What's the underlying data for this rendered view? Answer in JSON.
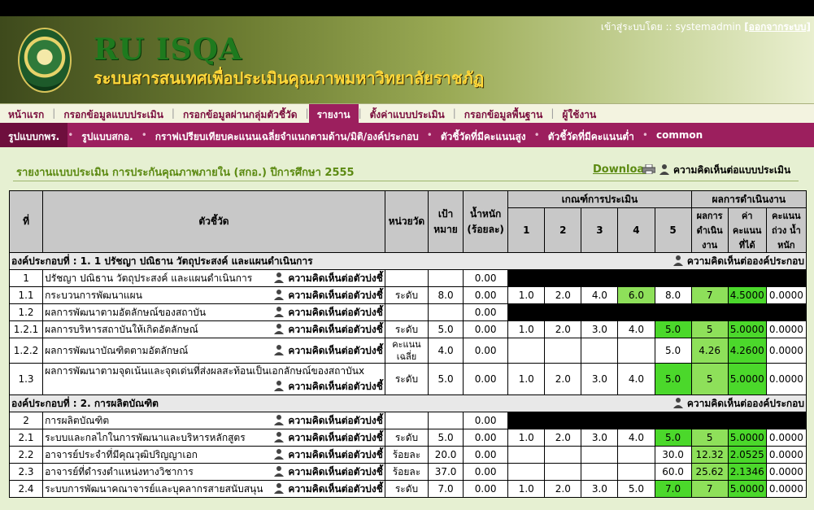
{
  "header": {
    "brand": "RU ISQA",
    "subtitle": "ระบบสารสนเทศเพื่อประเมินคุณภาพมหาวิทยาลัยราชภัฏ",
    "login_prefix": "เข้าสู่ระบบโดย :: systemadmin",
    "logout": "[ออกจากระบบ]"
  },
  "menu1": [
    "หน้าแรก",
    "กรอกข้อมูลแบบประเมิน",
    "กรอกข้อมูลผ่านกลุ่มตัวชี้วัด",
    "รายงาน",
    "ตั้งค่าแบบประเมิน",
    "กรอกข้อมูลพื้นฐาน",
    "ผู้ใช้งาน"
  ],
  "menu2": [
    "รูปแบบกพร.",
    "รูปแบบสกอ.",
    "กราฟเปรียบเทียบคะแนนเฉลี่ยจำแนกตามด้าน/มิติ/องค์ประกอบ",
    "ตัวชี้วัดที่มีคะแนนสูง",
    "ตัวชี้วัดที่มีคะแนนต่ำ",
    "common"
  ],
  "report": {
    "title": "รายงานแบบประเมิน การประกันคุณภาพภายใน (สกอ.) ปีการศึกษา 2555",
    "download": "Download",
    "comment_form": "ความคิดเห็นต่อแบบประเมิน"
  },
  "table": {
    "h_no": "ที่",
    "h_indicator": "ตัวชี้วัด",
    "h_unit": "หน่วยวัด",
    "h_target": "เป้า หมาย",
    "h_weight": "น้ำหนัก (ร้อยละ)",
    "h_criteria": "เกณฑ์การประเมิน",
    "h_levels": [
      "1",
      "2",
      "3",
      "4",
      "5"
    ],
    "h_result": "ผลการดำเนินงาน",
    "h_r1": "ผลการ ดำเนิน งาน",
    "h_r2": "ค่า คะแนน ที่ได้",
    "h_r3": "คะแนน ถ่วง น้ำหนัก",
    "comment_indicator": "ความคิดเห็นต่อตัวบ่งชี้",
    "comment_component": "ความคิดเห็นต่อองค์ประกอบ",
    "sections": [
      {
        "title": "องค์ประกอบที่ : 1. 1 ปรัชญา ปณิธาน วัตถุประสงค์ และแผนดำเนินการ",
        "rows": [
          {
            "no": "1",
            "name": "ปรัชญา ปณิธาน วัตถุประสงค์ และแผนดำเนินการ",
            "unit": "",
            "target": "",
            "weight": "0.00",
            "black": true
          },
          {
            "no": "1.1",
            "name": "กระบวนการพัฒนาแผน",
            "unit": "ระดับ",
            "target": "8.0",
            "weight": "0.00",
            "c": [
              "1.0",
              "2.0",
              "4.0",
              "6.0",
              "8.0"
            ],
            "hl": 3,
            "res": "7",
            "score": "4.5000",
            "wt": "0.0000"
          },
          {
            "no": "1.2",
            "name": "ผลการพัฒนาตามอัตลักษณ์ของสถาบัน",
            "unit": "",
            "target": "",
            "weight": "0.00",
            "black": true
          },
          {
            "no": "1.2.1",
            "name": "ผลการบริหารสถาบันให้เกิดอัตลักษณ์",
            "unit": "ระดับ",
            "target": "5.0",
            "weight": "0.00",
            "c": [
              "1.0",
              "2.0",
              "3.0",
              "4.0",
              "5.0"
            ],
            "hl": 4,
            "res": "5",
            "score": "5.0000",
            "wt": "0.0000"
          },
          {
            "no": "1.2.2",
            "name": "ผลการพัฒนาบัณฑิตตามอัตลักษณ์",
            "unit": "คะแนน เฉลี่ย",
            "target": "4.0",
            "weight": "0.00",
            "c": [
              "",
              "",
              "",
              "",
              "5.0"
            ],
            "hl": -1,
            "res": "4.26",
            "score": "4.2600",
            "wt": "0.0000"
          },
          {
            "no": "1.3",
            "name": "ผลการพัฒนาตามจุดเน้นและจุดเด่นที่ส่งผลสะท้อนเป็นเอกลักษณ์ของสถาบันx",
            "unit": "ระดับ",
            "target": "5.0",
            "weight": "0.00",
            "c": [
              "1.0",
              "2.0",
              "3.0",
              "4.0",
              "5.0"
            ],
            "hl": 4,
            "res": "5",
            "score": "5.0000",
            "wt": "0.0000",
            "tall": true
          }
        ]
      },
      {
        "title": "องค์ประกอบที่ : 2. การผลิตบัณฑิต",
        "rows": [
          {
            "no": "2",
            "name": "การผลิตบัณฑิต",
            "unit": "",
            "target": "",
            "weight": "0.00",
            "black": true
          },
          {
            "no": "2.1",
            "name": "ระบบและกลไกในการพัฒนาและบริหารหลักสูตร",
            "unit": "ระดับ",
            "target": "5.0",
            "weight": "0.00",
            "c": [
              "1.0",
              "2.0",
              "3.0",
              "4.0",
              "5.0"
            ],
            "hl": 4,
            "res": "5",
            "score": "5.0000",
            "wt": "0.0000"
          },
          {
            "no": "2.2",
            "name": "อาจารย์ประจำที่มีคุณวุฒิปริญญาเอก",
            "unit": "ร้อยละ",
            "target": "20.0",
            "weight": "0.00",
            "c": [
              "",
              "",
              "",
              "",
              "30.0"
            ],
            "hl": -1,
            "res": "12.32",
            "score": "2.0525",
            "wt": "0.0000"
          },
          {
            "no": "2.3",
            "name": "อาจารย์ที่ดำรงตำแหน่งทางวิชาการ",
            "unit": "ร้อยละ",
            "target": "37.0",
            "weight": "0.00",
            "c": [
              "",
              "",
              "",
              "",
              "60.0"
            ],
            "hl": -1,
            "res": "25.62",
            "score": "2.1346",
            "wt": "0.0000"
          },
          {
            "no": "2.4",
            "name": "ระบบการพัฒนาคณาจารย์และบุคลากรสายสนับสนุน",
            "unit": "ระดับ",
            "target": "7.0",
            "weight": "0.00",
            "c": [
              "1.0",
              "2.0",
              "3.0",
              "5.0",
              "7.0"
            ],
            "hl": 4,
            "res": "7",
            "score": "5.0000",
            "wt": "0.0000"
          }
        ]
      }
    ]
  },
  "colors": {
    "accent": "#9c1f5e",
    "green": "#4bd82b",
    "light_green": "#8ee05a"
  }
}
